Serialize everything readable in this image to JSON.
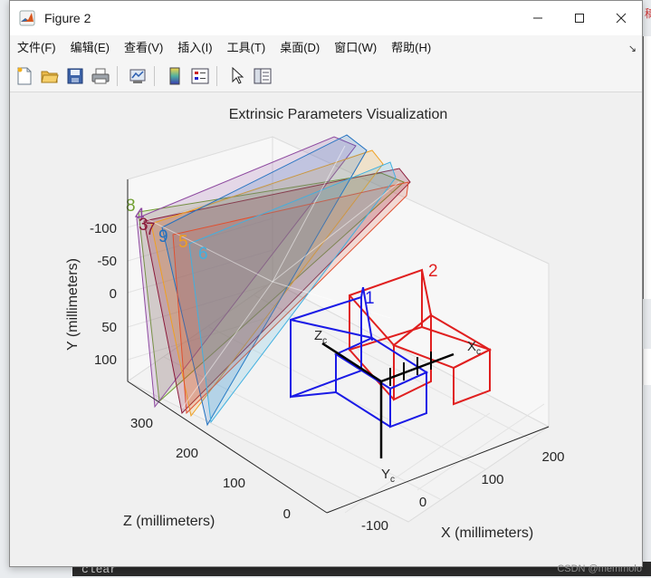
{
  "background": {
    "console_text": "clear",
    "watermark": "CSDN @memmolo"
  },
  "window": {
    "title": "Figure 2",
    "controls": [
      "minimize",
      "maximize",
      "close"
    ]
  },
  "menu": {
    "items": [
      "文件(F)",
      "编辑(E)",
      "查看(V)",
      "插入(I)",
      "工具(T)",
      "桌面(D)",
      "窗口(W)",
      "帮助(H)"
    ],
    "dock_arrow": "↘"
  },
  "toolbar": {
    "icons": [
      "new-figure-icon",
      "open-file-icon",
      "save-icon",
      "print-icon",
      "link-plot-icon",
      "insert-colorbar-icon",
      "insert-legend-icon",
      "edit-plot-icon",
      "property-inspector-icon"
    ]
  },
  "plot": {
    "title": "Extrinsic Parameters Visualization",
    "y_axis": {
      "label": "Y (millimeters)",
      "ticks": [
        "-100",
        "-50",
        "0",
        "50",
        "100"
      ]
    },
    "z_axis": {
      "label": "Z (millimeters)",
      "ticks": [
        "300",
        "200",
        "100",
        "0"
      ]
    },
    "x_axis": {
      "label": "X (millimeters)",
      "ticks": [
        "-100",
        "0",
        "100",
        "200"
      ]
    },
    "cameras": [
      {
        "label": "1",
        "color": "#2020e0"
      },
      {
        "label": "2",
        "color": "#e02020"
      }
    ],
    "camera_axes": {
      "x": "X",
      "x_sub": "c",
      "y": "Y",
      "y_sub": "c",
      "z": "Z",
      "z_sub": "c"
    },
    "boards": [
      {
        "label": "3",
        "color": "#8b1a3a"
      },
      {
        "label": "4",
        "color": "#8e4aa0"
      },
      {
        "label": "5",
        "color": "#f0a020"
      },
      {
        "label": "6",
        "color": "#40b0e0"
      },
      {
        "label": "7",
        "color": "#8b1a3a"
      },
      {
        "label": "8",
        "color": "#70a030"
      },
      {
        "label": "9",
        "color": "#2070c0"
      }
    ]
  }
}
